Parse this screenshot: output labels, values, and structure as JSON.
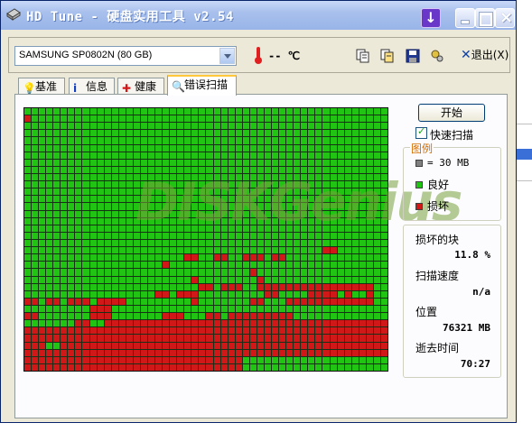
{
  "window": {
    "title": "HD Tune - 硬盘实用工具 v2.54"
  },
  "toolbar": {
    "drive_selected": "SAMSUNG SP0802N (80 GB)",
    "temperature": "-- ℃",
    "exit_label": "退出(X)"
  },
  "tabs": [
    {
      "label": "基准",
      "icon": "benchmark-icon",
      "active": false
    },
    {
      "label": "信息",
      "icon": "info-icon",
      "active": false
    },
    {
      "label": "健康",
      "icon": "health-icon",
      "active": false
    },
    {
      "label": "错误扫描",
      "icon": "search-icon",
      "active": true
    }
  ],
  "scan": {
    "start_label": "开始",
    "quick_scan_label": "快速扫描",
    "quick_scan_checked": true,
    "legend_title": "图例",
    "legend_block": "= 30 MB",
    "legend_good": "良好",
    "legend_bad": "损坏",
    "damaged_label": "损坏的块",
    "damaged_value": "11.8 %",
    "speed_label": "扫描速度",
    "speed_value": "n/a",
    "position_label": "位置",
    "position_value": "76321 MB",
    "elapsed_label": "逝去时间",
    "elapsed_value": "70:27",
    "watermark": "DISKGenius"
  },
  "colors": {
    "good": "#22c414",
    "bad": "#d01818",
    "block": "#808080"
  },
  "grid": {
    "columns": 50,
    "rows": 36,
    "bad_cells": [
      [
        1,
        0
      ],
      [
        19,
        41
      ],
      [
        19,
        42
      ],
      [
        20,
        22
      ],
      [
        20,
        23
      ],
      [
        20,
        26
      ],
      [
        20,
        27
      ],
      [
        20,
        30
      ],
      [
        20,
        31
      ],
      [
        20,
        32
      ],
      [
        20,
        34
      ],
      [
        20,
        35
      ],
      [
        21,
        19
      ],
      [
        22,
        31
      ],
      [
        23,
        23
      ],
      [
        23,
        32
      ],
      [
        24,
        24
      ],
      [
        24,
        25
      ],
      [
        24,
        27
      ],
      [
        24,
        28
      ],
      [
        24,
        29
      ],
      [
        24,
        32
      ],
      [
        24,
        33
      ],
      [
        24,
        34
      ],
      [
        24,
        35
      ],
      [
        24,
        36
      ],
      [
        24,
        37
      ],
      [
        24,
        38
      ],
      [
        24,
        39
      ],
      [
        24,
        40
      ],
      [
        24,
        41
      ],
      [
        24,
        42
      ],
      [
        24,
        43
      ],
      [
        24,
        44
      ],
      [
        24,
        45
      ],
      [
        24,
        46
      ],
      [
        24,
        47
      ],
      [
        25,
        18
      ],
      [
        25,
        19
      ],
      [
        25,
        21
      ],
      [
        25,
        22
      ],
      [
        25,
        23
      ],
      [
        25,
        33
      ],
      [
        25,
        34
      ],
      [
        25,
        39
      ],
      [
        25,
        40
      ],
      [
        25,
        41
      ],
      [
        25,
        42
      ],
      [
        25,
        44
      ],
      [
        25,
        47
      ],
      [
        26,
        0
      ],
      [
        26,
        1
      ],
      [
        26,
        3
      ],
      [
        26,
        4
      ],
      [
        26,
        6
      ],
      [
        26,
        7
      ],
      [
        26,
        8
      ],
      [
        26,
        10
      ],
      [
        26,
        11
      ],
      [
        26,
        12
      ],
      [
        26,
        13
      ],
      [
        26,
        23
      ],
      [
        26,
        31
      ],
      [
        26,
        32
      ],
      [
        26,
        36
      ],
      [
        26,
        37
      ],
      [
        26,
        38
      ],
      [
        26,
        39
      ],
      [
        26,
        40
      ],
      [
        26,
        41
      ],
      [
        26,
        42
      ],
      [
        26,
        43
      ],
      [
        26,
        44
      ],
      [
        26,
        45
      ],
      [
        26,
        46
      ],
      [
        26,
        47
      ],
      [
        27,
        9
      ],
      [
        27,
        10
      ],
      [
        27,
        11
      ],
      [
        28,
        0
      ],
      [
        28,
        1
      ],
      [
        28,
        9
      ],
      [
        28,
        10
      ],
      [
        28,
        11
      ],
      [
        28,
        19
      ],
      [
        28,
        20
      ],
      [
        28,
        21
      ],
      [
        28,
        25
      ],
      [
        28,
        26
      ],
      [
        28,
        28
      ],
      [
        28,
        29
      ],
      [
        28,
        30
      ],
      [
        28,
        31
      ],
      [
        28,
        32
      ],
      [
        28,
        33
      ],
      [
        28,
        34
      ],
      [
        28,
        35
      ],
      [
        28,
        36
      ],
      [
        29,
        7
      ],
      [
        29,
        8
      ],
      [
        29,
        11
      ],
      [
        29,
        12
      ],
      [
        29,
        13
      ],
      [
        29,
        14
      ],
      [
        29,
        15
      ],
      [
        29,
        16
      ],
      [
        29,
        17
      ],
      [
        29,
        18
      ],
      [
        29,
        19
      ],
      [
        29,
        20
      ],
      [
        29,
        21
      ],
      [
        29,
        22
      ],
      [
        29,
        23
      ],
      [
        29,
        24
      ],
      [
        29,
        25
      ],
      [
        29,
        26
      ],
      [
        29,
        27
      ],
      [
        29,
        28
      ],
      [
        29,
        29
      ],
      [
        29,
        30
      ],
      [
        29,
        31
      ],
      [
        29,
        32
      ],
      [
        29,
        33
      ],
      [
        29,
        34
      ],
      [
        29,
        35
      ],
      [
        29,
        36
      ],
      [
        29,
        37
      ],
      [
        29,
        38
      ],
      [
        29,
        39
      ],
      [
        29,
        40
      ],
      [
        29,
        41
      ],
      [
        29,
        42
      ],
      [
        29,
        43
      ],
      [
        29,
        44
      ],
      [
        29,
        45
      ],
      [
        29,
        46
      ],
      [
        29,
        47
      ],
      [
        29,
        48
      ],
      [
        29,
        49
      ],
      [
        30,
        0
      ],
      [
        30,
        1
      ],
      [
        30,
        2
      ],
      [
        30,
        3
      ],
      [
        30,
        4
      ],
      [
        30,
        5
      ],
      [
        30,
        6
      ],
      [
        30,
        7
      ],
      [
        30,
        8
      ],
      [
        30,
        9
      ],
      [
        30,
        10
      ],
      [
        30,
        11
      ],
      [
        30,
        12
      ],
      [
        30,
        13
      ],
      [
        30,
        14
      ],
      [
        30,
        15
      ],
      [
        30,
        16
      ],
      [
        30,
        17
      ],
      [
        30,
        18
      ],
      [
        30,
        19
      ],
      [
        30,
        20
      ],
      [
        30,
        21
      ],
      [
        30,
        22
      ],
      [
        30,
        23
      ],
      [
        30,
        24
      ],
      [
        30,
        25
      ],
      [
        30,
        26
      ],
      [
        30,
        27
      ],
      [
        30,
        28
      ],
      [
        30,
        29
      ],
      [
        30,
        30
      ],
      [
        30,
        31
      ],
      [
        30,
        32
      ],
      [
        30,
        33
      ],
      [
        30,
        34
      ],
      [
        30,
        35
      ],
      [
        30,
        36
      ],
      [
        30,
        37
      ],
      [
        30,
        38
      ],
      [
        30,
        39
      ],
      [
        30,
        40
      ],
      [
        30,
        41
      ],
      [
        30,
        42
      ],
      [
        30,
        43
      ],
      [
        30,
        44
      ],
      [
        30,
        45
      ],
      [
        30,
        46
      ],
      [
        30,
        47
      ],
      [
        30,
        48
      ],
      [
        30,
        49
      ],
      [
        31,
        0
      ],
      [
        31,
        1
      ],
      [
        31,
        2
      ],
      [
        31,
        3
      ],
      [
        31,
        4
      ],
      [
        31,
        5
      ],
      [
        31,
        6
      ],
      [
        31,
        7
      ],
      [
        31,
        8
      ],
      [
        31,
        9
      ],
      [
        31,
        10
      ],
      [
        31,
        11
      ],
      [
        31,
        12
      ],
      [
        31,
        13
      ],
      [
        31,
        14
      ],
      [
        31,
        15
      ],
      [
        31,
        16
      ],
      [
        31,
        17
      ],
      [
        31,
        18
      ],
      [
        31,
        19
      ],
      [
        31,
        20
      ],
      [
        31,
        21
      ],
      [
        31,
        22
      ],
      [
        31,
        23
      ],
      [
        31,
        24
      ],
      [
        31,
        25
      ],
      [
        31,
        26
      ],
      [
        31,
        27
      ],
      [
        31,
        28
      ],
      [
        31,
        29
      ],
      [
        31,
        30
      ],
      [
        31,
        31
      ],
      [
        31,
        32
      ],
      [
        31,
        33
      ],
      [
        31,
        34
      ],
      [
        31,
        35
      ],
      [
        31,
        36
      ],
      [
        31,
        37
      ],
      [
        31,
        38
      ],
      [
        31,
        39
      ],
      [
        31,
        40
      ],
      [
        31,
        41
      ],
      [
        31,
        42
      ],
      [
        31,
        43
      ],
      [
        31,
        44
      ],
      [
        31,
        45
      ],
      [
        31,
        46
      ],
      [
        31,
        47
      ],
      [
        31,
        48
      ],
      [
        31,
        49
      ],
      [
        32,
        0
      ],
      [
        32,
        1
      ],
      [
        32,
        2
      ],
      [
        32,
        5
      ],
      [
        32,
        6
      ],
      [
        32,
        7
      ],
      [
        32,
        8
      ],
      [
        32,
        9
      ],
      [
        32,
        10
      ],
      [
        32,
        11
      ],
      [
        32,
        12
      ],
      [
        32,
        13
      ],
      [
        32,
        14
      ],
      [
        32,
        15
      ],
      [
        32,
        16
      ],
      [
        32,
        17
      ],
      [
        32,
        18
      ],
      [
        32,
        19
      ],
      [
        32,
        20
      ],
      [
        32,
        21
      ],
      [
        32,
        22
      ],
      [
        32,
        23
      ],
      [
        32,
        24
      ],
      [
        32,
        25
      ],
      [
        32,
        26
      ],
      [
        32,
        27
      ],
      [
        32,
        28
      ],
      [
        32,
        29
      ],
      [
        32,
        30
      ],
      [
        32,
        31
      ],
      [
        32,
        32
      ],
      [
        32,
        33
      ],
      [
        32,
        34
      ],
      [
        32,
        35
      ],
      [
        32,
        36
      ],
      [
        32,
        37
      ],
      [
        32,
        38
      ],
      [
        32,
        39
      ],
      [
        32,
        40
      ],
      [
        32,
        41
      ],
      [
        32,
        42
      ],
      [
        32,
        43
      ],
      [
        32,
        44
      ],
      [
        32,
        45
      ],
      [
        32,
        46
      ],
      [
        32,
        47
      ],
      [
        32,
        48
      ],
      [
        32,
        49
      ],
      [
        33,
        0
      ],
      [
        33,
        1
      ],
      [
        33,
        2
      ],
      [
        33,
        3
      ],
      [
        33,
        4
      ],
      [
        33,
        5
      ],
      [
        33,
        6
      ],
      [
        33,
        7
      ],
      [
        33,
        8
      ],
      [
        33,
        9
      ],
      [
        33,
        10
      ],
      [
        33,
        11
      ],
      [
        33,
        12
      ],
      [
        33,
        13
      ],
      [
        33,
        14
      ],
      [
        33,
        15
      ],
      [
        33,
        16
      ],
      [
        33,
        17
      ],
      [
        33,
        18
      ],
      [
        33,
        19
      ],
      [
        33,
        20
      ],
      [
        33,
        21
      ],
      [
        33,
        22
      ],
      [
        33,
        23
      ],
      [
        33,
        24
      ],
      [
        33,
        25
      ],
      [
        33,
        26
      ],
      [
        33,
        27
      ],
      [
        33,
        28
      ],
      [
        33,
        29
      ],
      [
        33,
        30
      ],
      [
        33,
        31
      ],
      [
        33,
        32
      ],
      [
        33,
        33
      ],
      [
        33,
        34
      ],
      [
        33,
        35
      ],
      [
        33,
        36
      ],
      [
        33,
        37
      ],
      [
        33,
        38
      ],
      [
        33,
        39
      ],
      [
        33,
        40
      ],
      [
        33,
        41
      ],
      [
        33,
        42
      ],
      [
        33,
        43
      ],
      [
        33,
        44
      ],
      [
        33,
        45
      ],
      [
        33,
        46
      ],
      [
        33,
        47
      ],
      [
        33,
        48
      ],
      [
        33,
        49
      ],
      [
        34,
        0
      ],
      [
        34,
        1
      ],
      [
        34,
        2
      ],
      [
        34,
        3
      ],
      [
        34,
        4
      ],
      [
        34,
        5
      ],
      [
        34,
        6
      ],
      [
        34,
        7
      ],
      [
        34,
        8
      ],
      [
        34,
        9
      ],
      [
        34,
        10
      ],
      [
        34,
        11
      ],
      [
        34,
        12
      ],
      [
        34,
        13
      ],
      [
        34,
        14
      ],
      [
        34,
        15
      ],
      [
        34,
        16
      ],
      [
        34,
        17
      ],
      [
        34,
        18
      ],
      [
        34,
        19
      ],
      [
        34,
        20
      ],
      [
        34,
        21
      ],
      [
        34,
        22
      ],
      [
        34,
        23
      ],
      [
        34,
        24
      ],
      [
        34,
        25
      ],
      [
        34,
        26
      ],
      [
        34,
        27
      ],
      [
        34,
        28
      ],
      [
        34,
        29
      ],
      [
        35,
        0
      ],
      [
        35,
        1
      ],
      [
        35,
        2
      ],
      [
        35,
        3
      ],
      [
        35,
        4
      ],
      [
        35,
        5
      ],
      [
        35,
        6
      ],
      [
        35,
        7
      ],
      [
        35,
        8
      ],
      [
        35,
        9
      ],
      [
        35,
        10
      ],
      [
        35,
        11
      ],
      [
        35,
        12
      ],
      [
        35,
        13
      ],
      [
        35,
        14
      ],
      [
        35,
        15
      ],
      [
        35,
        16
      ],
      [
        35,
        17
      ],
      [
        35,
        18
      ],
      [
        35,
        19
      ],
      [
        35,
        20
      ],
      [
        35,
        21
      ],
      [
        35,
        22
      ],
      [
        35,
        23
      ],
      [
        35,
        24
      ],
      [
        35,
        25
      ],
      [
        35,
        26
      ],
      [
        35,
        27
      ],
      [
        35,
        28
      ],
      [
        35,
        29
      ]
    ]
  }
}
